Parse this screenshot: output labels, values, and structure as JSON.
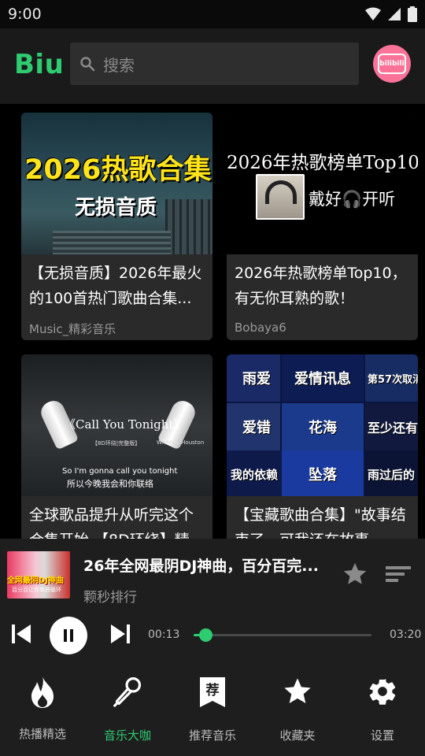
{
  "status_bar": {
    "time": "9:00",
    "icons": [
      "wifi-icon",
      "signal-icon",
      "battery-icon"
    ]
  },
  "app_bar": {
    "logo": "Biu",
    "search_placeholder": "搜索",
    "account_icon": "bilibili-icon",
    "account_label": "bilibili"
  },
  "cards": [
    {
      "title": "【无损音质】2026年最火的100首热门歌曲合集...",
      "author": "Music_精彩音乐",
      "thumb_text": [
        "2026热歌合集",
        "无损音质"
      ]
    },
    {
      "title": "2026年热歌榜单Top10，有无你耳熟的歌！",
      "author": "Bobaya6",
      "thumb_text": [
        "2026年热歌榜单Top10",
        "戴好🎧开听"
      ]
    },
    {
      "title": "全球歌品提升从听完这个合集开始 【8D环绕】精",
      "author": "",
      "thumb_text": [
        "《Call You Tonight》",
        "【8D环绕|完整版】",
        "Whitney Houston",
        "So I'm gonna call you tonight",
        "所以今晚我会和你联络"
      ]
    },
    {
      "title": "【宝藏歌曲合集】\"故事结束了，可我还在故事",
      "author": "",
      "thumb_text": [
        "雨爱",
        "爱情讯息",
        "第57次取消",
        "爱错",
        "花海",
        "至少还有",
        "我的依赖",
        "坠落",
        "雨过后的"
      ]
    }
  ],
  "player": {
    "title": "26年全网最阴DJ神曲，百分百完...",
    "artist": "颗秒排行",
    "cover_text": [
      "全网最阴DJ神曲",
      "百分百让你单曲循环"
    ],
    "current_time": "00:13",
    "total_time": "03:20",
    "progress": 0.065
  },
  "bottom_nav": [
    {
      "label": "热播精选",
      "icon": "flame-icon",
      "active": false
    },
    {
      "label": "音乐大咖",
      "icon": "microphone-icon",
      "active": true
    },
    {
      "label": "推荐音乐",
      "icon": "recommend-icon",
      "icon_text": "荐",
      "active": false
    },
    {
      "label": "收藏夹",
      "icon": "star-icon",
      "active": false
    },
    {
      "label": "设置",
      "icon": "gear-icon",
      "active": false
    }
  ],
  "colors": {
    "accent": "#2ecc71",
    "background": "#000000",
    "card": "#2a2a2a",
    "bilibili_pink": "#fb7299"
  }
}
